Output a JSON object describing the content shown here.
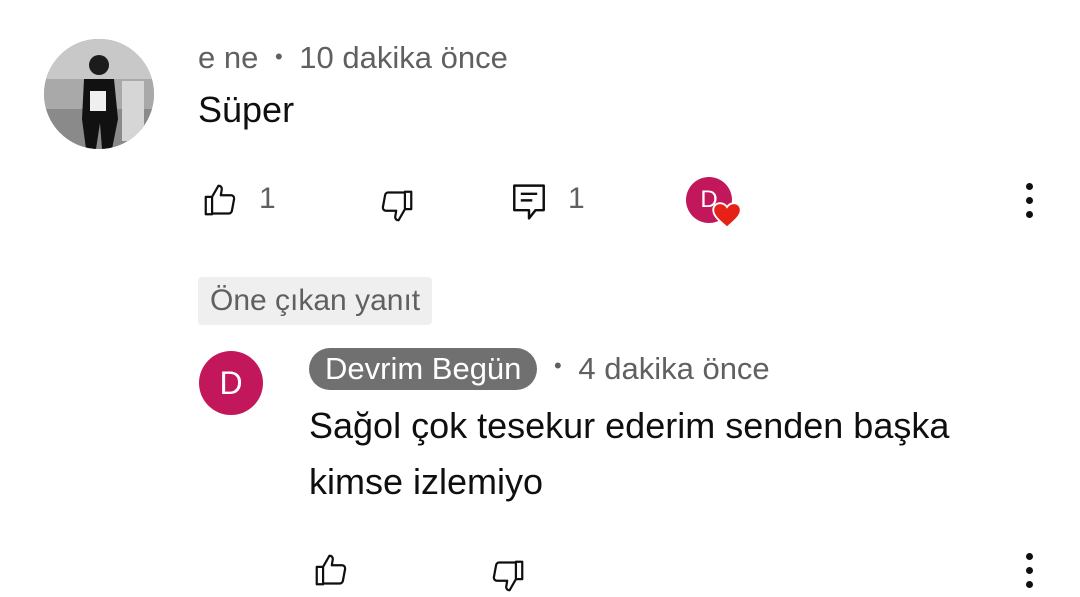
{
  "comment": {
    "author": "e ne",
    "separator": "•",
    "time": "10 dakika önce",
    "text": "Süper",
    "like_count": "1",
    "reply_count": "1",
    "creator_heart": {
      "initial": "D",
      "avatar_color": "#c2185b",
      "heart_color": "#e62117"
    }
  },
  "pinned_label": "Öne çıkan yanıt",
  "reply": {
    "avatar_initial": "D",
    "avatar_color": "#c2185b",
    "author": "Devrim Begün",
    "separator": "•",
    "time": "4 dakika önce",
    "text_line1": "Sağol çok tesekur ederim senden başka",
    "text_line2": "kimse izlemiyo"
  },
  "icons": [
    "thumbs-up-icon",
    "thumbs-down-icon",
    "reply-icon",
    "more-vert-icon",
    "heart-icon"
  ]
}
